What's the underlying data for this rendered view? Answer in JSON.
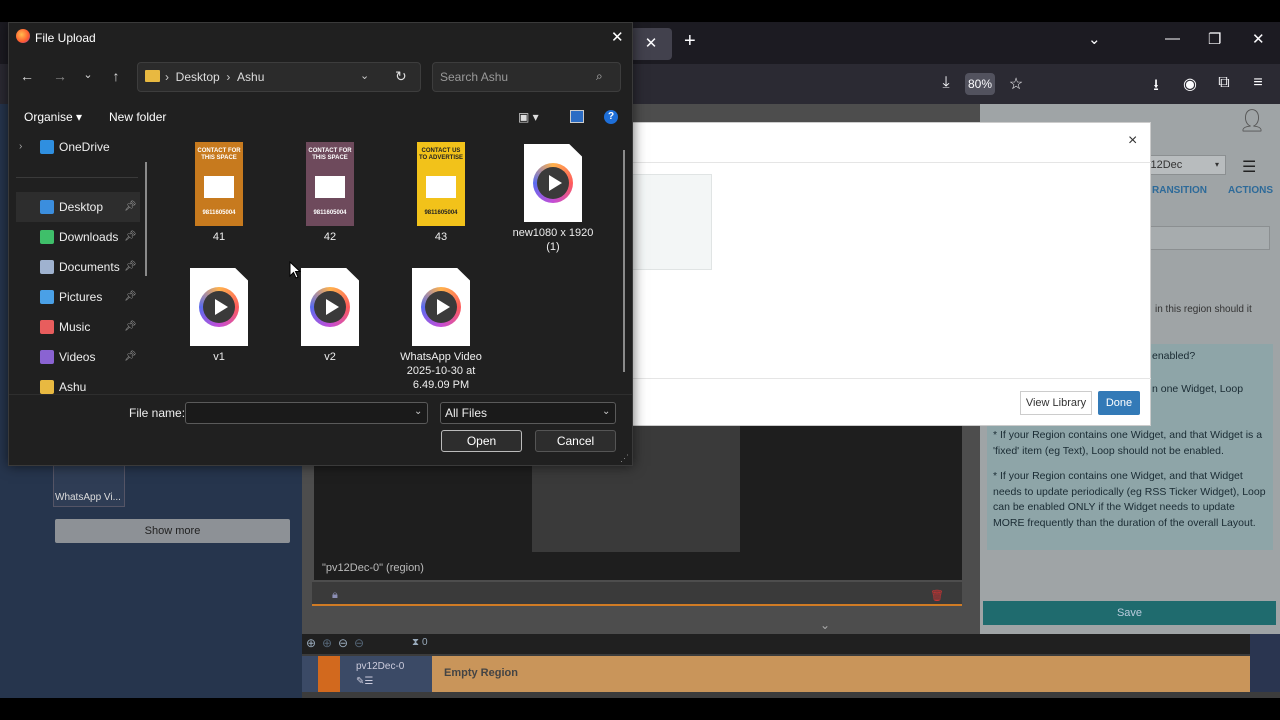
{
  "browser": {
    "zoom": "80%",
    "tab_close": "✕",
    "new_tab": "+",
    "minimize": "—",
    "restore": "❐",
    "close": "✕",
    "list_all_tabs": "⌄"
  },
  "dialog": {
    "title": "File Upload",
    "breadcrumb": [
      "Desktop",
      "Ashu"
    ],
    "search_placeholder": "Search Ashu",
    "organise": "Organise ▾",
    "new_folder": "New folder",
    "nav_items": [
      {
        "label": "OneDrive",
        "icon_color": "#2f8fe0",
        "pinned": false
      },
      {
        "label": "Desktop",
        "icon_color": "#3b8ede",
        "pinned": true
      },
      {
        "label": "Downloads",
        "icon_color": "#3fbf6a",
        "pinned": true
      },
      {
        "label": "Documents",
        "icon_color": "#9fb2cf",
        "pinned": true
      },
      {
        "label": "Pictures",
        "icon_color": "#4aa0e6",
        "pinned": true
      },
      {
        "label": "Music",
        "icon_color": "#e85d5d",
        "pinned": true
      },
      {
        "label": "Videos",
        "icon_color": "#8a63d2",
        "pinned": true
      },
      {
        "label": "Ashu",
        "icon_color": "#e8b941",
        "pinned": false
      }
    ],
    "files": [
      {
        "name": "41",
        "kind": "image",
        "bg": "#c77a1e",
        "top_text": "CONTACT FOR THIS SPACE",
        "bottom_text": "9811605004"
      },
      {
        "name": "42",
        "kind": "image",
        "bg": "#6e4a5c",
        "top_text": "CONTACT FOR THIS SPACE",
        "bottom_text": "9811605004"
      },
      {
        "name": "43",
        "kind": "image",
        "bg": "#f2c21a",
        "top_text": "CONTACT US TO ADVERTISE",
        "bottom_text": "9811605004"
      },
      {
        "name": "new1080 x 1920\n(1)",
        "kind": "video"
      },
      {
        "name": "v1",
        "kind": "video"
      },
      {
        "name": "v2",
        "kind": "video"
      },
      {
        "name": "WhatsApp Video\n2025-10-30 at\n6.49.09 PM",
        "kind": "video"
      }
    ],
    "file_name_label": "File name:",
    "file_name_value": "",
    "file_type": "All Files",
    "open_label": "Open",
    "cancel_label": "Cancel"
  },
  "modal": {
    "close": "×",
    "view_library": "View Library",
    "done": "Done"
  },
  "layout_editor": {
    "thumb_label": "WhatsApp Vi...",
    "show_more": "Show more",
    "region_label": "\"pv12Dec-0\" (region)",
    "timeline_count": "0",
    "timeline_name": "pv12Dec-0",
    "empty_region": "Empty Region"
  },
  "right_panel": {
    "select_value": "v12Dec",
    "tab_transition": "RANSITION",
    "tab_actions": "ACTIONS",
    "hint": "in this region should it",
    "enabled": "enabled?",
    "loop_text": "n one Widget, Loop",
    "help_p1": "* If your Region contains one Widget, and that Widget is a 'fixed' item (eg Text), Loop should not be enabled.",
    "help_p2": "* If your Region contains one Widget, and that Widget needs to update periodically (eg RSS Ticker Widget), Loop can be enabled ONLY if the Widget needs to update MORE frequently than the duration of the overall Layout.",
    "save": "Save"
  }
}
